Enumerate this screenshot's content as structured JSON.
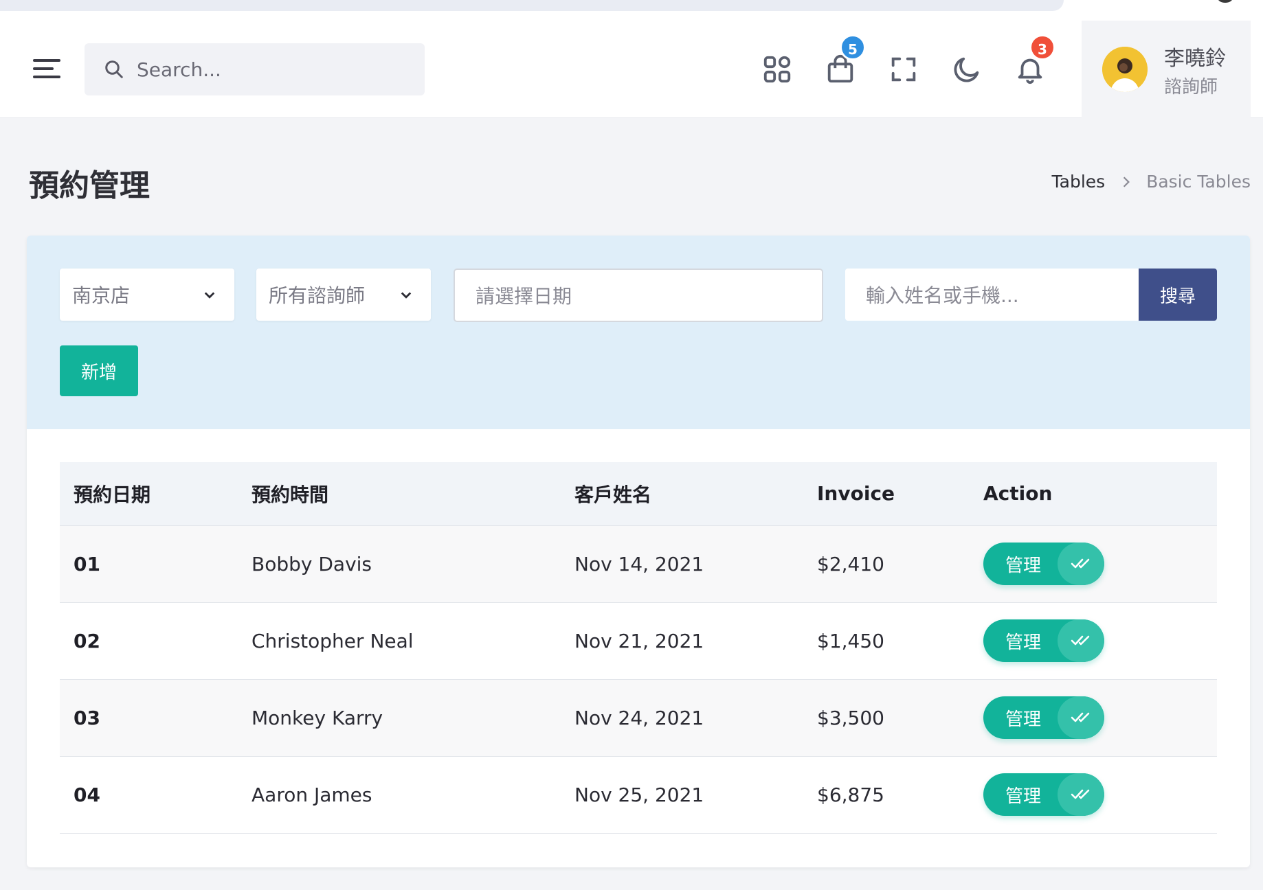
{
  "header": {
    "search_placeholder": "Search...",
    "cart_badge": "5",
    "notification_badge": "3",
    "user_name": "李曉鈴",
    "user_role": "諮詢師"
  },
  "page": {
    "title": "預約管理",
    "breadcrumb": [
      "Tables",
      "Basic Tables"
    ]
  },
  "filters": {
    "store_select": "南京店",
    "consultant_select": "所有諮詢師",
    "date_placeholder": "請選擇日期",
    "name_placeholder": "輸入姓名或手機...",
    "search_button": "搜尋",
    "add_button": "新增"
  },
  "table": {
    "columns": [
      "預約日期",
      "預約時間",
      "客戶姓名",
      "Invoice",
      "Action"
    ],
    "rows": [
      {
        "id": "01",
        "name": "Bobby Davis",
        "date": "Nov 14, 2021",
        "invoice": "$2,410",
        "action": "管理"
      },
      {
        "id": "02",
        "name": "Christopher Neal",
        "date": "Nov 21, 2021",
        "invoice": "$1,450",
        "action": "管理"
      },
      {
        "id": "03",
        "name": "Monkey Karry",
        "date": "Nov 24, 2021",
        "invoice": "$3,500",
        "action": "管理"
      },
      {
        "id": "04",
        "name": "Aaron James",
        "date": "Nov 25, 2021",
        "invoice": "$6,875",
        "action": "管理"
      }
    ]
  },
  "icons": [
    "hamburger-menu-icon",
    "search-icon",
    "apps-grid-icon",
    "shopping-bag-icon",
    "fullscreen-icon",
    "dark-mode-moon-icon",
    "notification-bell-icon",
    "chevron-down-icon",
    "double-check-icon",
    "chevron-right-icon"
  ],
  "colors": {
    "accent_teal": "#12b39a",
    "search_button": "#3f4f8a",
    "filter_bg": "#dfeef9",
    "badge_blue": "#2f8fe0",
    "badge_red": "#f04f39"
  }
}
